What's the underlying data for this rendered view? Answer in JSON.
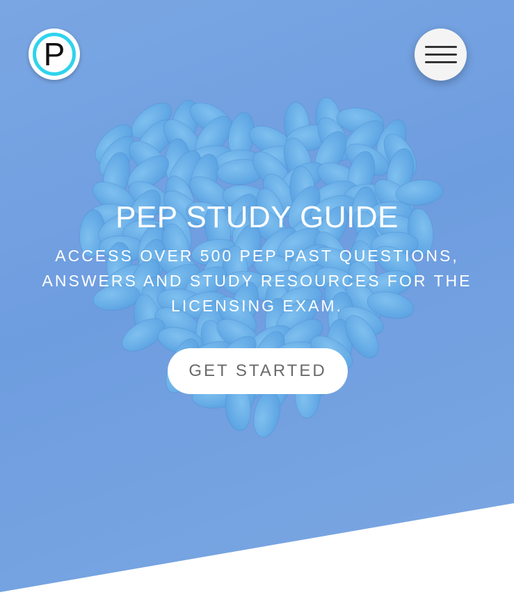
{
  "brand": {
    "logo_letter": "P",
    "accent_color": "#2fd3ee"
  },
  "header": {
    "menu_icon": "hamburger-menu-icon"
  },
  "hero": {
    "title": "PEP STUDY GUIDE",
    "subtitle": "ACCESS OVER 500 PEP PAST QUESTIONS, ANSWERS AND STUDY RESOURCES FOR THE LICENSING EXAM.",
    "cta_label": "GET STARTED",
    "background_color": "#75a3e2",
    "image": "heart-of-pills-image"
  }
}
